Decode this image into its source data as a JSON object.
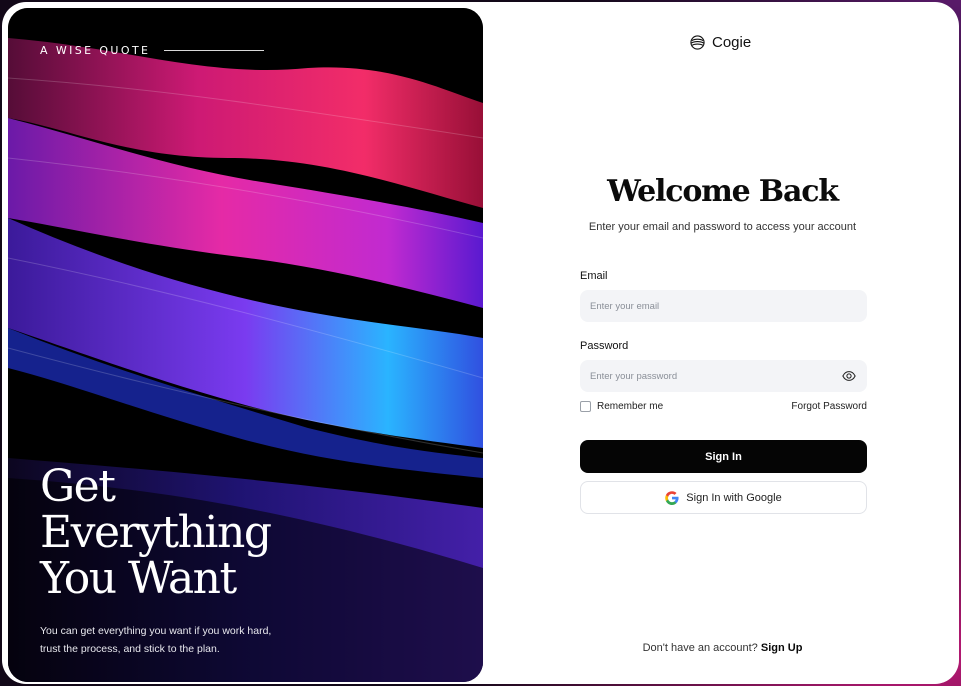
{
  "quote": {
    "header": "A WISE QUOTE",
    "headline": [
      "Get",
      "Everything",
      "You Want"
    ],
    "body": "You can get everything you want if you work hard, trust the process, and stick to the plan."
  },
  "brand": {
    "name": "Cogie",
    "icon": "stacked-waves-logo-icon"
  },
  "form": {
    "title": "Welcome Back",
    "subtitle": "Enter your email and password to access your account",
    "email_label": "Email",
    "email_placeholder": "Enter your email",
    "email_value": "",
    "password_label": "Password",
    "password_placeholder": "Enter your password",
    "password_value": "",
    "remember_label": "Remember me",
    "remember_checked": false,
    "forgot_label": "Forgot Password",
    "signin_label": "Sign In",
    "google_label": "Sign In with Google"
  },
  "footer": {
    "prompt": "Don't have an account?",
    "signup_label": "Sign Up"
  },
  "colors": {
    "primary_button": "#050505",
    "input_bg": "#f3f4f7",
    "art_magenta": "#e0218a",
    "art_violet": "#7a2bd8",
    "art_blue": "#2f7cff"
  }
}
